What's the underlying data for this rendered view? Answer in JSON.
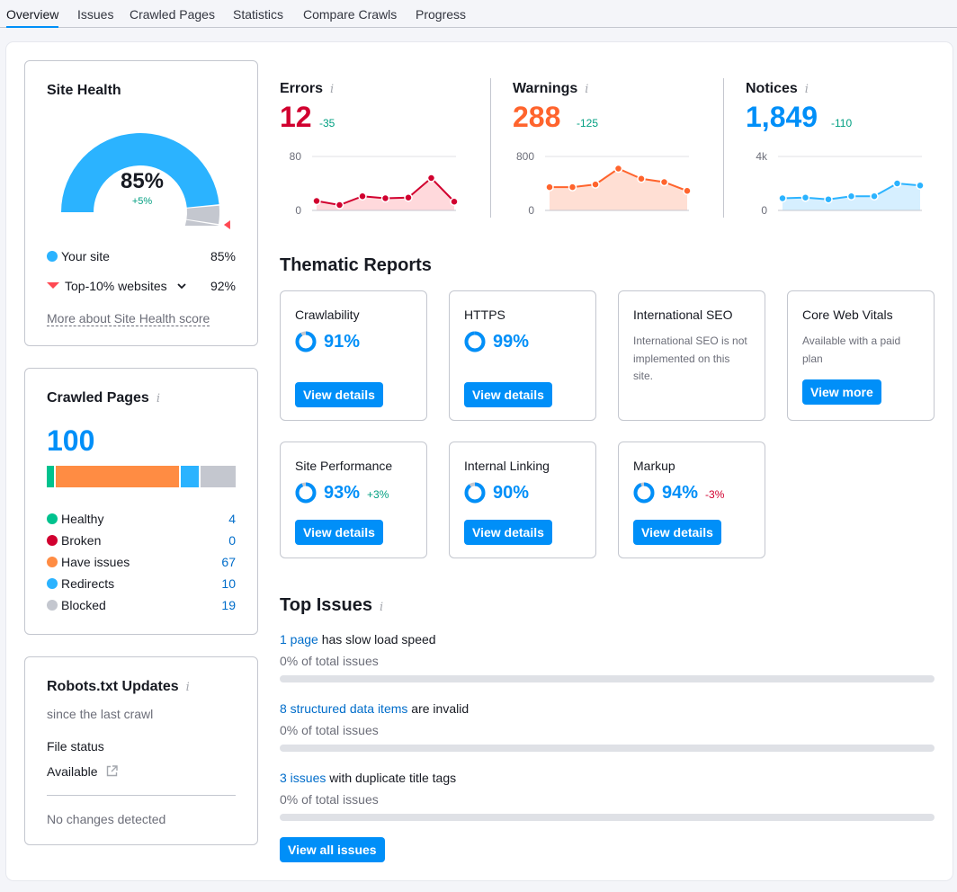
{
  "tabs": [
    {
      "label": "Overview",
      "active": true
    },
    {
      "label": "Issues"
    },
    {
      "label": "Crawled Pages"
    },
    {
      "label": "Statistics"
    },
    {
      "label": "Compare Crawls"
    },
    {
      "label": "Progress"
    }
  ],
  "site_health": {
    "title": "Site Health",
    "value": "85%",
    "value_fraction": 0.85,
    "top10_fraction": 0.92,
    "delta": "+5%",
    "legend": [
      {
        "label": "Your site",
        "value": "85%",
        "color": "#2bb3ff"
      },
      {
        "label": "Top-10% websites",
        "value": "92%",
        "color": "#ff4953"
      }
    ],
    "more_link": "More about Site Health score"
  },
  "crawled_pages": {
    "title": "Crawled Pages",
    "total": "100",
    "items": [
      {
        "label": "Healthy",
        "value": "4",
        "count": 4,
        "color": "#00c28e"
      },
      {
        "label": "Broken",
        "value": "0",
        "count": 0,
        "color": "#d1002f"
      },
      {
        "label": "Have issues",
        "value": "67",
        "count": 67,
        "color": "#ff8c43"
      },
      {
        "label": "Redirects",
        "value": "10",
        "count": 10,
        "color": "#2bb3ff"
      },
      {
        "label": "Blocked",
        "value": "19",
        "count": 19,
        "color": "#c4c7cf"
      }
    ]
  },
  "robots": {
    "title": "Robots.txt Updates",
    "subtitle": "since the last crawl",
    "file_status_label": "File status",
    "file_status_value": "Available",
    "changes": "No changes detected"
  },
  "metrics": [
    {
      "title": "Errors",
      "value": "12",
      "delta": "-35",
      "color": "#d1002f",
      "fill": "#ffd9dc",
      "y_max_label": "80",
      "y_max": 80,
      "y_min_label": "0",
      "points": [
        14,
        8,
        21,
        18,
        19,
        48,
        13
      ]
    },
    {
      "title": "Warnings",
      "value": "288",
      "delta": "-125",
      "color": "#ff642d",
      "fill": "#ffdfd4",
      "y_max_label": "800",
      "y_max": 800,
      "y_min_label": "0",
      "points": [
        345,
        345,
        385,
        620,
        470,
        420,
        290
      ]
    },
    {
      "title": "Notices",
      "value": "1,849",
      "delta": "-110",
      "color": "#2bb3ff",
      "fill": "#d6efff",
      "y_max_label": "4k",
      "y_max": 4000,
      "y_min_label": "0",
      "points": [
        900,
        950,
        820,
        1050,
        1050,
        2000,
        1849
      ]
    }
  ],
  "thematic": {
    "title": "Thematic Reports",
    "cards": [
      {
        "name": "Crawlability",
        "score": "91%",
        "score_fraction": 0.91,
        "delta": "",
        "button": "View details"
      },
      {
        "name": "HTTPS",
        "score": "99%",
        "score_fraction": 0.99,
        "delta": "",
        "button": "View details"
      },
      {
        "name": "International SEO",
        "desc": "International SEO is not implemented on this site."
      },
      {
        "name": "Core Web Vitals",
        "desc": "Available with a paid plan",
        "button": "View more"
      },
      {
        "name": "Site Performance",
        "score": "93%",
        "score_fraction": 0.93,
        "delta": "+3%",
        "delta_color": "#009f81",
        "button": "View details"
      },
      {
        "name": "Internal Linking",
        "score": "90%",
        "score_fraction": 0.9,
        "delta": "",
        "button": "View details"
      },
      {
        "name": "Markup",
        "score": "94%",
        "score_fraction": 0.94,
        "delta": "-3%",
        "delta_color": "#d1002f",
        "button": "View details"
      }
    ]
  },
  "top_issues": {
    "title": "Top Issues",
    "items": [
      {
        "link": "1 page",
        "text": " has slow load speed",
        "sub": "0% of total issues",
        "fraction": 0
      },
      {
        "link": "8 structured data items",
        "text": " are invalid",
        "sub": "0% of total issues",
        "fraction": 0
      },
      {
        "link": "3 issues",
        "text": " with duplicate title tags",
        "sub": "0% of total issues",
        "fraction": 0
      }
    ],
    "button": "View all issues"
  }
}
